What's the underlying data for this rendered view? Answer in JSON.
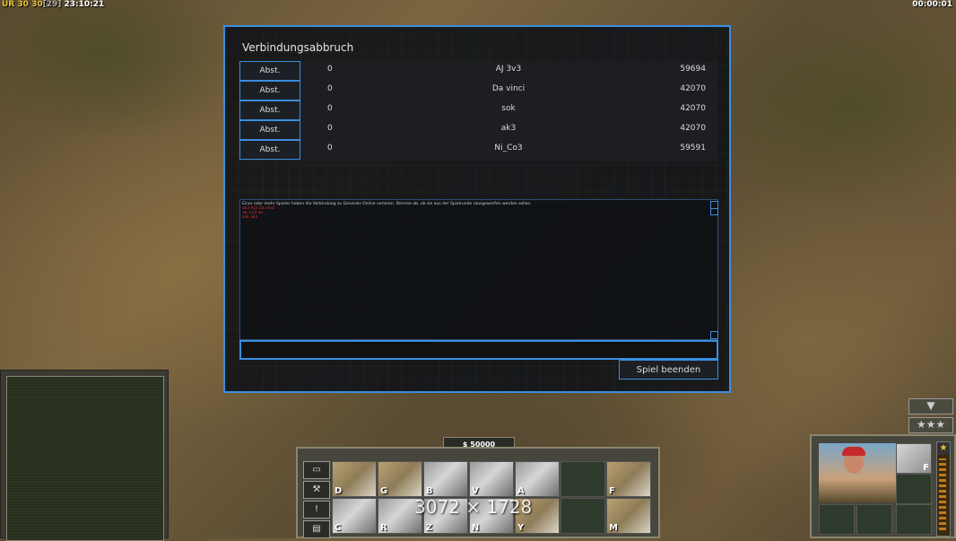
{
  "hud": {
    "rank": "UR",
    "val_a": "30",
    "val_b": "30",
    "val_c": "[29]",
    "clock": "23:10:21",
    "timer": "00:00:01"
  },
  "dialog": {
    "title": "Verbindungsabbruch",
    "rows": [
      {
        "button": "Abst.",
        "count": "0",
        "name": "AJ 3v3",
        "value": "59694"
      },
      {
        "button": "Abst.",
        "count": "0",
        "name": "Da vinci",
        "value": "42070"
      },
      {
        "button": "Abst.",
        "count": "0",
        "name": "sok",
        "value": "42070"
      },
      {
        "button": "Abst.",
        "count": "0",
        "name": "ak3",
        "value": "42070"
      },
      {
        "button": "Abst.",
        "count": "0",
        "name": "Ni_Co3",
        "value": "59591"
      }
    ],
    "log": {
      "message": "Einer oder mehr Spieler haben die Verbindung zu Generals Online verloren. Stimme ab, ob sie aus der Spielrunde rausgeworfen werden sollen.",
      "red_lines": [
        "ak3 AJ3 Da vinci",
        "ak_Co3 ak",
        "sok ak3"
      ]
    },
    "end_button": "Spiel beenden"
  },
  "command_bar": {
    "money": "$ 50000",
    "resolution_overlay": "3072 × 1728",
    "hotkeys_row1": [
      "D",
      "G",
      "B",
      "V",
      "A",
      "",
      "F"
    ],
    "hotkeys_row2": [
      "C",
      "R",
      "Z",
      "N",
      "Y",
      "",
      "M"
    ],
    "side_buttons": [
      "▭",
      "⚒",
      "!",
      "▤"
    ]
  },
  "unit_panel": {
    "slot_key": "F",
    "rank_symbol": "★"
  }
}
